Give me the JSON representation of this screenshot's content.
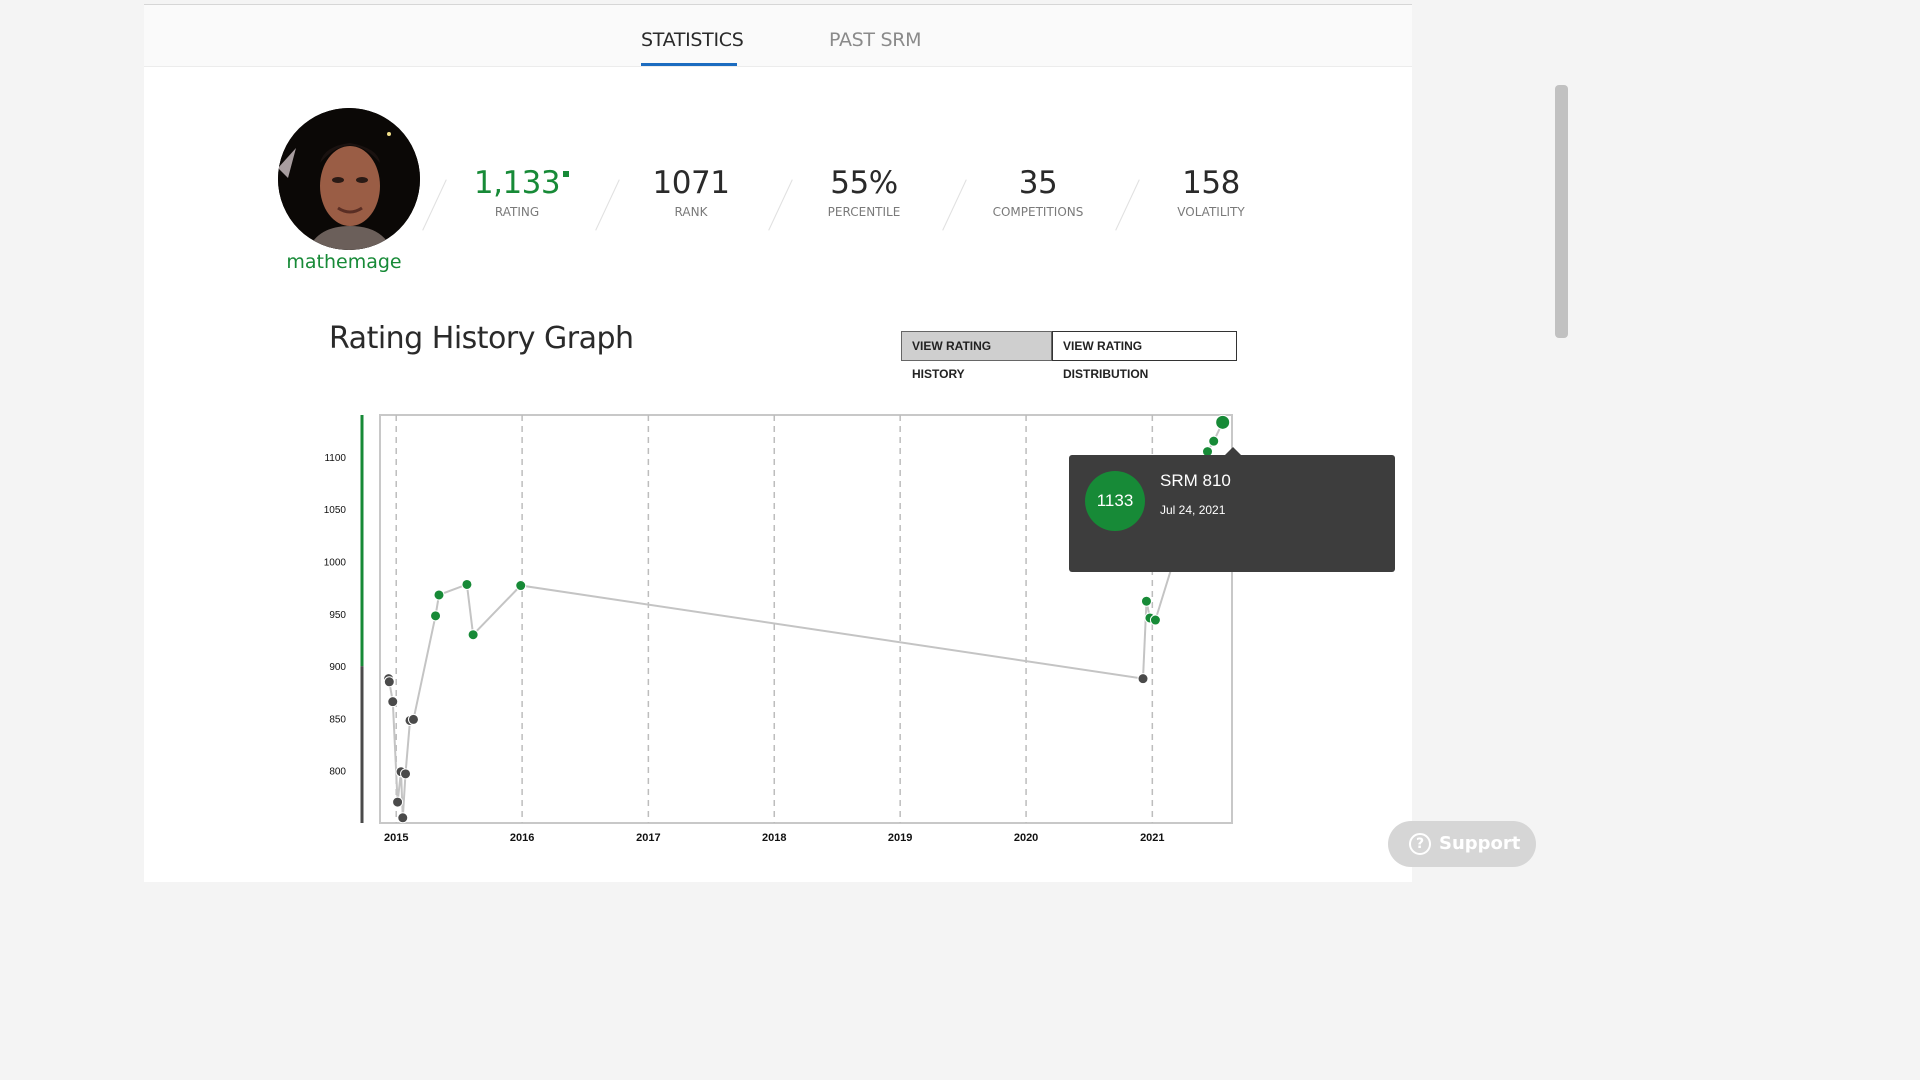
{
  "tabs": [
    {
      "label": "STATISTICS",
      "active": true
    },
    {
      "label": "PAST SRM",
      "active": false
    }
  ],
  "profile": {
    "handle": "mathemage",
    "handle_color": "#178a37"
  },
  "stats": [
    {
      "value": "1,133",
      "label": "RATING"
    },
    {
      "value": "1071",
      "label": "RANK"
    },
    {
      "value": "55%",
      "label": "PERCENTILE"
    },
    {
      "value": "35",
      "label": "COMPETITIONS"
    },
    {
      "value": "158",
      "label": "VOLATILITY"
    }
  ],
  "graph": {
    "title": "Rating History Graph",
    "buttons": {
      "history": "VIEW RATING HISTORY",
      "distribution": "VIEW RATING DISTRIBUTION"
    }
  },
  "tooltip": {
    "rating": "1133",
    "contest": "SRM 810",
    "date": "Jul 24, 2021"
  },
  "support": {
    "label": "Support",
    "icon": "question-circle-icon"
  },
  "colors": {
    "green": "#178a37",
    "gray": "#4a4a4a",
    "accent": "#1c6cc0"
  },
  "chart_data": {
    "type": "line",
    "title": "",
    "xlabel": "",
    "ylabel": "",
    "x_ticks": [
      "2015",
      "2016",
      "2017",
      "2018",
      "2019",
      "2020",
      "2021"
    ],
    "y_ticks": [
      800,
      850,
      900,
      950,
      1000,
      1050,
      1100
    ],
    "ylim": [
      750,
      1140
    ],
    "xlim": [
      "2014-11-15",
      "2021-08-20"
    ],
    "grid": "vertical-dashed",
    "series": [
      {
        "points": [
          {
            "date": "2014-12-10",
            "rating": 888
          },
          {
            "date": "2014-12-12",
            "rating": 885
          },
          {
            "date": "2014-12-22",
            "rating": 866
          },
          {
            "date": "2015-01-05",
            "rating": 770
          },
          {
            "date": "2015-01-15",
            "rating": 799
          },
          {
            "date": "2015-01-20",
            "rating": 755
          },
          {
            "date": "2015-01-28",
            "rating": 797
          },
          {
            "date": "2015-02-10",
            "rating": 848
          },
          {
            "date": "2015-02-20",
            "rating": 849
          },
          {
            "date": "2015-04-25",
            "rating": 948
          },
          {
            "date": "2015-05-05",
            "rating": 968
          },
          {
            "date": "2015-07-25",
            "rating": 978
          },
          {
            "date": "2015-08-12",
            "rating": 930
          },
          {
            "date": "2015-12-28",
            "rating": 977
          },
          {
            "date": "2020-12-05",
            "rating": 888
          },
          {
            "date": "2020-12-15",
            "rating": 962
          },
          {
            "date": "2020-12-25",
            "rating": 946
          },
          {
            "date": "2021-01-10",
            "rating": 944
          },
          {
            "date": "2021-06-10",
            "rating": 1105
          },
          {
            "date": "2021-06-28",
            "rating": 1115
          },
          {
            "date": "2021-07-24",
            "rating": 1133
          }
        ]
      }
    ],
    "threshold": 900,
    "color_above": "#178a37",
    "color_below": "#4a4a4a"
  }
}
